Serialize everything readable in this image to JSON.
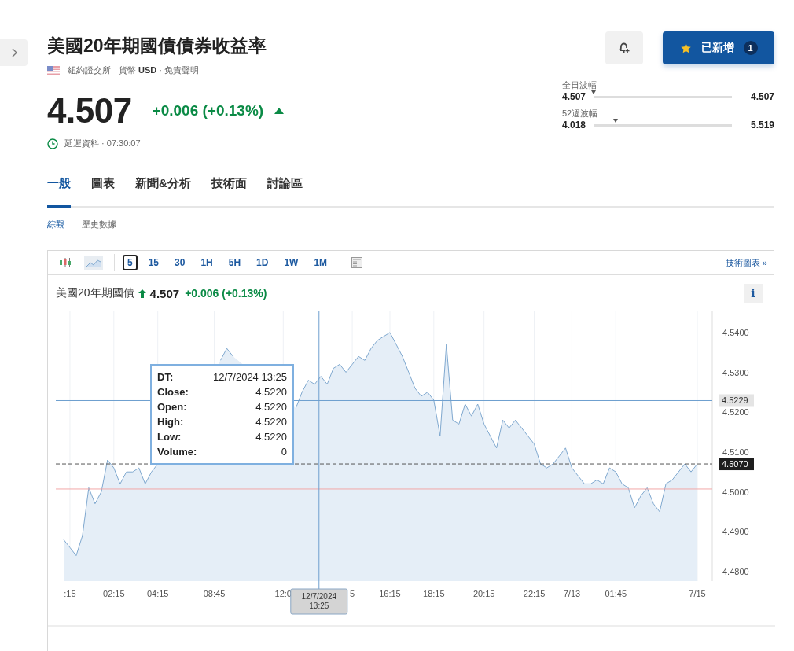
{
  "header": {
    "title": "美國20年期國債債券收益率",
    "exchange": "紐約證交所",
    "meta": "貨幣 **USD** · 免責聲明",
    "price": "4.507",
    "change": "+0.006 (+0.13%)",
    "rising": true,
    "delayed": "延遲資料 · 07:30:07"
  },
  "watchlist_button": {
    "label": "已新增",
    "count": "1"
  },
  "ranges": [
    {
      "title": "全日波幅",
      "low": "4.507",
      "high": "4.507",
      "level": 0.0
    },
    {
      "title": "52週波幅",
      "low": "4.018",
      "high": "5.519",
      "level": 0.16
    }
  ],
  "tabs": [
    {
      "label": "一般",
      "selected": true
    },
    {
      "label": "圖表",
      "selected": false
    },
    {
      "label": "新聞&分析",
      "selected": false
    },
    {
      "label": "技術面",
      "selected": false
    },
    {
      "label": "討論區",
      "selected": false
    }
  ],
  "subtabs": [
    {
      "label": "綜觀",
      "selected": true
    },
    {
      "label": "歷史數據",
      "selected": false
    }
  ],
  "chart_widget": {
    "chart_types": [
      {
        "kind": "candle"
      },
      {
        "kind": "area"
      }
    ],
    "intervals": [
      {
        "label": "5",
        "selected": true
      },
      {
        "label": "15",
        "selected": false
      },
      {
        "label": "30",
        "selected": false
      },
      {
        "label": "1H",
        "selected": false
      },
      {
        "label": "5H",
        "selected": false
      },
      {
        "label": "1D",
        "selected": false
      },
      {
        "label": "1W",
        "selected": false
      },
      {
        "label": "1M",
        "selected": false
      }
    ],
    "link": "技術圖表 »",
    "price": "4.507",
    "change": "+0.006 (+0.13%)",
    "rising": true,
    "info": "i",
    "tooltip": [
      {
        "label": "DT:",
        "value": "12/7/2024 13:25"
      },
      {
        "label": "Close:",
        "value": "4.5220"
      },
      {
        "label": "Open:",
        "value": "4.5220"
      },
      {
        "label": "High:",
        "value": "4.5220"
      },
      {
        "label": "Low:",
        "value": "4.5220"
      },
      {
        "label": "Volume:",
        "value": "0"
      }
    ],
    "crosshair_date": [
      "12/7/2024",
      "13:25"
    ],
    "chart_data": {
      "type": "area",
      "grid": true,
      "categories": [
        null,
        ":15",
        null,
        null,
        null,
        null,
        null,
        null,
        "02:15",
        null,
        null,
        null,
        null,
        null,
        null,
        "04:15",
        null,
        null,
        null,
        null,
        null,
        null,
        null,
        null,
        "08:45",
        null,
        null,
        null,
        null,
        null,
        null,
        null,
        null,
        null,
        null,
        "12:0",
        null,
        null,
        null,
        null,
        null,
        null,
        null,
        null,
        null,
        null,
        "5",
        null,
        null,
        null,
        null,
        null,
        "16:15",
        null,
        null,
        null,
        null,
        null,
        null,
        "18:15",
        null,
        null,
        null,
        null,
        null,
        null,
        null,
        "20:15",
        null,
        null,
        null,
        null,
        null,
        null,
        null,
        "22:15",
        null,
        null,
        null,
        null,
        null,
        "7/13",
        null,
        null,
        null,
        null,
        null,
        null,
        "01:45",
        null,
        null,
        null,
        null,
        null,
        null,
        null,
        null,
        null,
        null,
        null,
        null,
        "7/15"
      ],
      "series": [
        {
          "name": "美國20年期國債",
          "color": "#7fa8cf",
          "values": [
            4.488,
            4.486,
            4.484,
            4.489,
            4.501,
            4.497,
            4.5,
            4.508,
            4.506,
            4.502,
            4.505,
            4.505,
            4.506,
            4.502,
            4.505,
            4.507,
            null,
            null,
            null,
            null,
            null,
            null,
            null,
            null,
            null,
            4.533,
            4.536,
            4.534,
            null,
            null,
            null,
            null,
            null,
            null,
            null,
            null,
            null,
            4.521,
            4.525,
            4.528,
            4.527,
            4.529,
            4.527,
            4.531,
            4.532,
            4.53,
            4.532,
            4.534,
            4.533,
            4.536,
            4.538,
            4.539,
            4.54,
            4.537,
            4.534,
            4.53,
            4.526,
            4.524,
            4.525,
            4.523,
            4.514,
            4.537,
            4.518,
            4.517,
            4.522,
            4.519,
            4.522,
            4.517,
            4.514,
            4.511,
            4.518,
            4.516,
            4.518,
            4.516,
            4.514,
            4.512,
            4.507,
            4.506,
            4.507,
            4.509,
            4.511,
            4.506,
            4.504,
            4.502,
            4.502,
            4.503,
            4.502,
            4.506,
            4.505,
            4.502,
            4.501,
            4.496,
            4.499,
            4.501,
            4.497,
            4.495,
            4.502,
            4.503,
            4.505,
            4.507,
            4.505,
            4.507
          ]
        }
      ],
      "ylim": [
        4.4776,
        4.5453
      ],
      "yticks": [
        {
          "value": 4.48,
          "label": "4.4800"
        },
        {
          "value": 4.49,
          "label": "4.4900"
        },
        {
          "value": 4.5,
          "label": "4.5000"
        },
        {
          "value": 4.51,
          "label": "4.5100"
        },
        {
          "value": 4.52,
          "label": "4.5200"
        },
        {
          "value": 4.53,
          "label": "4.5300"
        },
        {
          "value": 4.54,
          "label": "4.5400"
        }
      ],
      "ref_lines": [
        {
          "axis": "y",
          "value": 4.5007,
          "color": "#f2a7a7"
        },
        {
          "axis": "y",
          "value": 4.507,
          "color": "#555555",
          "label": "4.5070"
        },
        {
          "axis": "y",
          "value": 4.5229,
          "color": "#6e9fcf",
          "label": "4.5229"
        }
      ]
    }
  }
}
